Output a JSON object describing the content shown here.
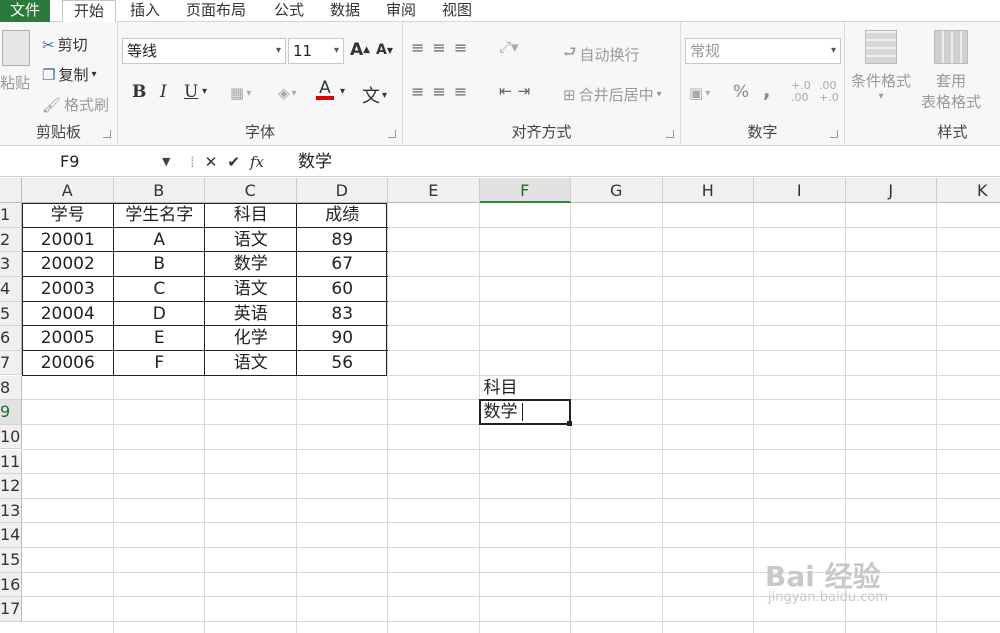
{
  "menu": {
    "tabs": [
      "文件",
      "开始",
      "插入",
      "页面布局",
      "公式",
      "数据",
      "审阅",
      "视图"
    ]
  },
  "ribbon": {
    "clipboard": {
      "paste": "粘贴",
      "cut": "剪切",
      "copy": "复制",
      "format_painter": "格式刷",
      "label": "剪贴板"
    },
    "font": {
      "name": "等线",
      "size": "11",
      "label": "字体",
      "bold": "B",
      "italic": "I",
      "underline": "U",
      "grow": "A",
      "shrink": "A",
      "font_color": "A",
      "wen": "文"
    },
    "alignment": {
      "wrap": "自动换行",
      "merge": "合并后居中",
      "label": "对齐方式"
    },
    "number": {
      "format": "常规",
      "percent": "%",
      "comma": ",",
      "inc_decimal": "+.0 .00",
      "dec_decimal": ".00 +.0",
      "label": "数字"
    },
    "styles": {
      "conditional": "条件格式",
      "table_format_1": "套用",
      "table_format_2": "表格格式",
      "label": "样式"
    }
  },
  "formula_bar": {
    "name_box": "F9",
    "formula": "数学",
    "fx": "fx"
  },
  "columns": [
    "A",
    "B",
    "C",
    "D",
    "E",
    "F",
    "G",
    "H",
    "I",
    "J",
    "K"
  ],
  "selected_column": "F",
  "rows": [
    "1",
    "2",
    "3",
    "4",
    "5",
    "6",
    "7",
    "8",
    "9",
    "10",
    "11",
    "12",
    "13",
    "14",
    "15",
    "16",
    "17"
  ],
  "selected_row": "9",
  "table": {
    "header": [
      "学号",
      "学生名字",
      "科目",
      "成绩"
    ],
    "rows": [
      [
        "20001",
        "A",
        "语文",
        "89"
      ],
      [
        "20002",
        "B",
        "数学",
        "67"
      ],
      [
        "20003",
        "C",
        "语文",
        "60"
      ],
      [
        "20004",
        "D",
        "英语",
        "83"
      ],
      [
        "20005",
        "E",
        "化学",
        "90"
      ],
      [
        "20006",
        "F",
        "语文",
        "56"
      ]
    ]
  },
  "criteria": {
    "F8": "科目",
    "F9": "数学"
  },
  "watermark": {
    "brand": "Bai 经验",
    "url": "jingyan.baidu.com"
  },
  "colors": {
    "accent": "#2a7a3a",
    "selected_header": "#1d6b2c"
  }
}
